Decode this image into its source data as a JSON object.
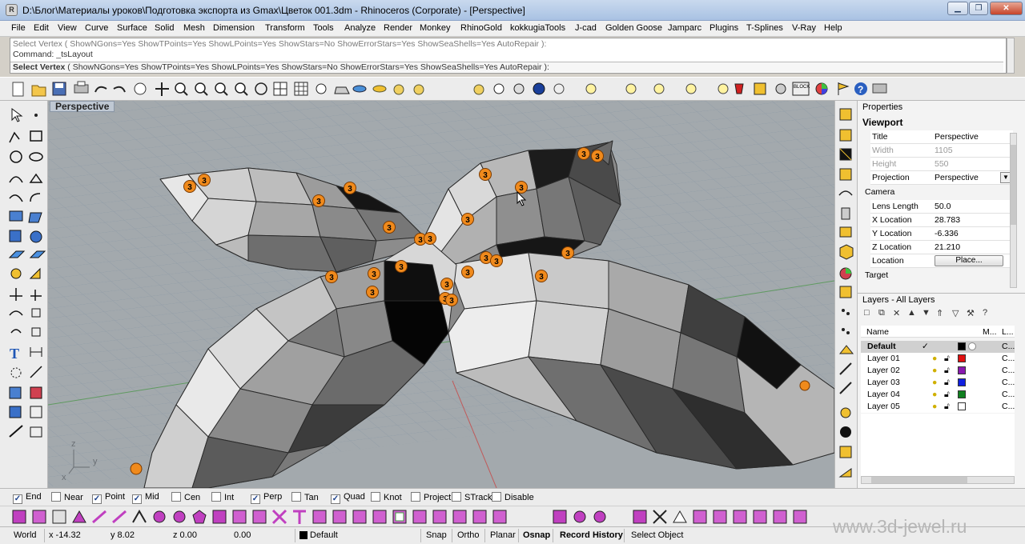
{
  "window": {
    "title": "D:\\Блог\\Материалы уроков\\Подготовка экспорта из Gmax\\Цветок 001.3dm - Rhinoceros (Corporate) - [Perspective]",
    "app_icon_letter": "R"
  },
  "menu": [
    "File",
    "Edit",
    "View",
    "Curve",
    "Surface",
    "Solid",
    "Mesh",
    "Dimension",
    "Transform",
    "Tools",
    "Analyze",
    "Render",
    "Monkey",
    "RhinoGold",
    "kokkugiaTools",
    "J-cad",
    "Golden Goose",
    "Jamparc",
    "Plugins",
    "T-Splines",
    "V-Ray",
    "Help"
  ],
  "command": {
    "history_1": "Select Vertex ( ShowNGons=Yes  ShowTPoints=Yes  ShowLPoints=Yes  ShowStars=No  ShowErrorStars=Yes  ShowSeaShells=Yes  AutoRepair ):",
    "history_2": "Command: _tsLayout",
    "prompt_label": "Select Vertex",
    "prompt_options": " ( ShowNGons=Yes  ShowTPoints=Yes  ShowLPoints=Yes  ShowStars=No  ShowErrorStars=Yes  ShowSeaShells=Yes  AutoRepair ):"
  },
  "viewport": {
    "label": "Perspective",
    "vertex_badge": "3",
    "axis_labels": {
      "z": "z",
      "x": "x",
      "y": "y"
    }
  },
  "properties": {
    "header": "Properties",
    "section": "Viewport",
    "rows": [
      {
        "key": "Title",
        "value": "Perspective",
        "dim": false
      },
      {
        "key": "Width",
        "value": "1105",
        "dim": true
      },
      {
        "key": "Height",
        "value": "550",
        "dim": true
      },
      {
        "key": "Projection",
        "value": "Perspective",
        "dim": false
      }
    ],
    "camera_label": "Camera",
    "camera_rows": [
      {
        "key": "Lens Length",
        "value": "50.0"
      },
      {
        "key": "X Location",
        "value": "28.783"
      },
      {
        "key": "Y Location",
        "value": "-6.336"
      },
      {
        "key": "Z Location",
        "value": "21.210"
      },
      {
        "key": "Location",
        "value": "Place..."
      }
    ],
    "target_label": "Target"
  },
  "layers": {
    "header": "Layers - All Layers",
    "col_name": "Name",
    "col_m": "M...",
    "col_l": "L...",
    "items": [
      {
        "name": "Default",
        "current": "✓",
        "color": "#000000",
        "c": "C..."
      },
      {
        "name": "Layer 01",
        "current": "",
        "color": "#e01010",
        "c": "C..."
      },
      {
        "name": "Layer 02",
        "current": "",
        "color": "#8a1ab0",
        "c": "C..."
      },
      {
        "name": "Layer 03",
        "current": "",
        "color": "#1020e0",
        "c": "C..."
      },
      {
        "name": "Layer 04",
        "current": "",
        "color": "#108020",
        "c": "C..."
      },
      {
        "name": "Layer 05",
        "current": "",
        "color": "#ffffff",
        "c": "C..."
      }
    ]
  },
  "osnap": [
    {
      "label": "End",
      "checked": true
    },
    {
      "label": "Near",
      "checked": false
    },
    {
      "label": "Point",
      "checked": true
    },
    {
      "label": "Mid",
      "checked": true
    },
    {
      "label": "Cen",
      "checked": false
    },
    {
      "label": "Int",
      "checked": false
    },
    {
      "label": "Perp",
      "checked": true
    },
    {
      "label": "Tan",
      "checked": false
    },
    {
      "label": "Quad",
      "checked": true
    },
    {
      "label": "Knot",
      "checked": false
    },
    {
      "label": "Project",
      "checked": false
    },
    {
      "label": "STrack",
      "checked": false
    },
    {
      "label": "Disable",
      "checked": false
    }
  ],
  "status": {
    "cplane": "World",
    "x": "x -14.32",
    "y": "y 8.02",
    "z": "z 0.00",
    "dist": "0.00",
    "layer": "Default",
    "snap": "Snap",
    "ortho": "Ortho",
    "planar": "Planar",
    "osnap": "Osnap",
    "record_history": "Record History",
    "filter": "Select Object"
  },
  "watermark": "www.3d-jewel.ru",
  "colors": {
    "viewport_bg": "#a3a9ad",
    "grid": "#8fa0b0",
    "vertex_badge": "#f08a1c"
  }
}
